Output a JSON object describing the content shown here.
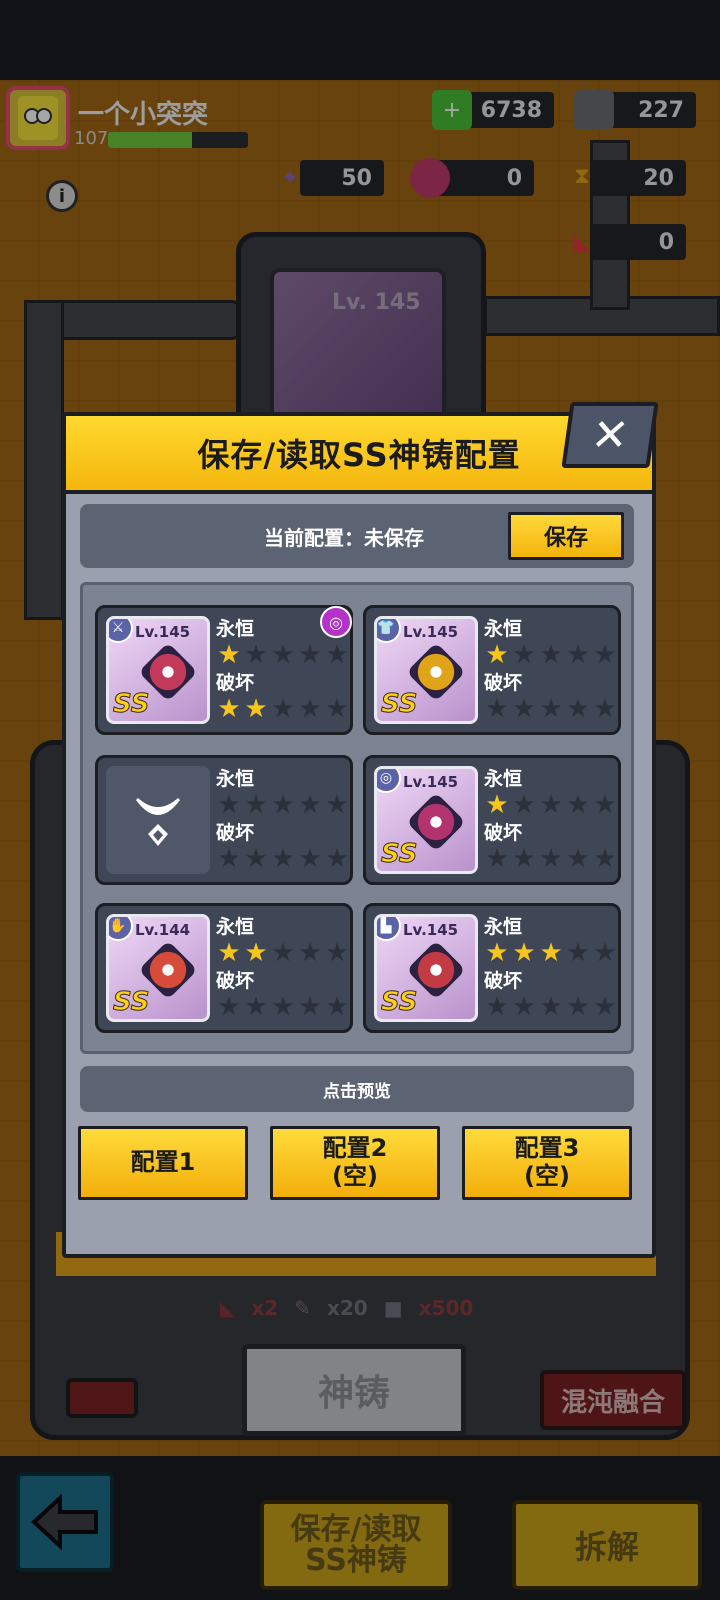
{
  "hud": {
    "player_name": "一个小突突",
    "level": "107",
    "xp_fraction": 0.6,
    "resources": [
      {
        "icon": "green-cube-plus-icon",
        "value": "6738"
      },
      {
        "icon": "gray-cube-icon",
        "value": "227"
      },
      {
        "icon": "purple-shard-icon",
        "value": "50"
      },
      {
        "icon": "red-orb-icon",
        "value": "0"
      },
      {
        "icon": "hourglass-icon",
        "value": "20"
      },
      {
        "icon": "red-ticket-icon",
        "value": "0"
      }
    ],
    "info_icon": "i"
  },
  "background": {
    "machine_card_lv": "Lv. 145",
    "cost": {
      "ticket": "x2",
      "brush": "x20",
      "cube": "x500"
    },
    "forge_label": "神铸",
    "chaos_label": "混沌融合",
    "save_load_label_1": "保存/读取",
    "save_load_label_2": "SS神铸",
    "dismantle_label": "拆解"
  },
  "dialog": {
    "title": "保存/读取SS神铸配置",
    "close_label": "✕",
    "status_label": "当前配置：未保存",
    "save_label": "保存",
    "preview_label": "点击预览",
    "config_buttons": [
      {
        "line1": "配置1",
        "line2": ""
      },
      {
        "line1": "配置2",
        "line2": "(空)"
      },
      {
        "line1": "配置3",
        "line2": "(空)"
      }
    ],
    "slots": [
      {
        "lv": "Lv.145",
        "type_icon": "weapon-icon",
        "eternal_label": "永恒",
        "eternal_stars": 1,
        "destroy_label": "破坏",
        "destroy_stars": 2,
        "empty": false,
        "gem_color": "#c23a5a",
        "badge": true
      },
      {
        "lv": "Lv.145",
        "type_icon": "armor-icon",
        "eternal_label": "永恒",
        "eternal_stars": 1,
        "destroy_label": "破坏",
        "destroy_stars": 0,
        "empty": false,
        "gem_color": "#e0a418",
        "badge": false
      },
      {
        "lv": "",
        "type_icon": "necklace-icon",
        "eternal_label": "永恒",
        "eternal_stars": 0,
        "destroy_label": "破坏",
        "destroy_stars": 0,
        "empty": true,
        "gem_color": "#505768",
        "badge": false
      },
      {
        "lv": "Lv.145",
        "type_icon": "belt-icon",
        "eternal_label": "永恒",
        "eternal_stars": 1,
        "destroy_label": "破坏",
        "destroy_stars": 0,
        "empty": false,
        "gem_color": "#b3336f",
        "badge": false
      },
      {
        "lv": "Lv.144",
        "type_icon": "glove-icon",
        "eternal_label": "永恒",
        "eternal_stars": 2,
        "destroy_label": "破坏",
        "destroy_stars": 0,
        "empty": false,
        "gem_color": "#d64b3a",
        "badge": false
      },
      {
        "lv": "Lv.145",
        "type_icon": "boot-icon",
        "eternal_label": "永恒",
        "eternal_stars": 3,
        "destroy_label": "破坏",
        "destroy_stars": 0,
        "empty": false,
        "gem_color": "#c13a44",
        "badge": false
      }
    ]
  }
}
